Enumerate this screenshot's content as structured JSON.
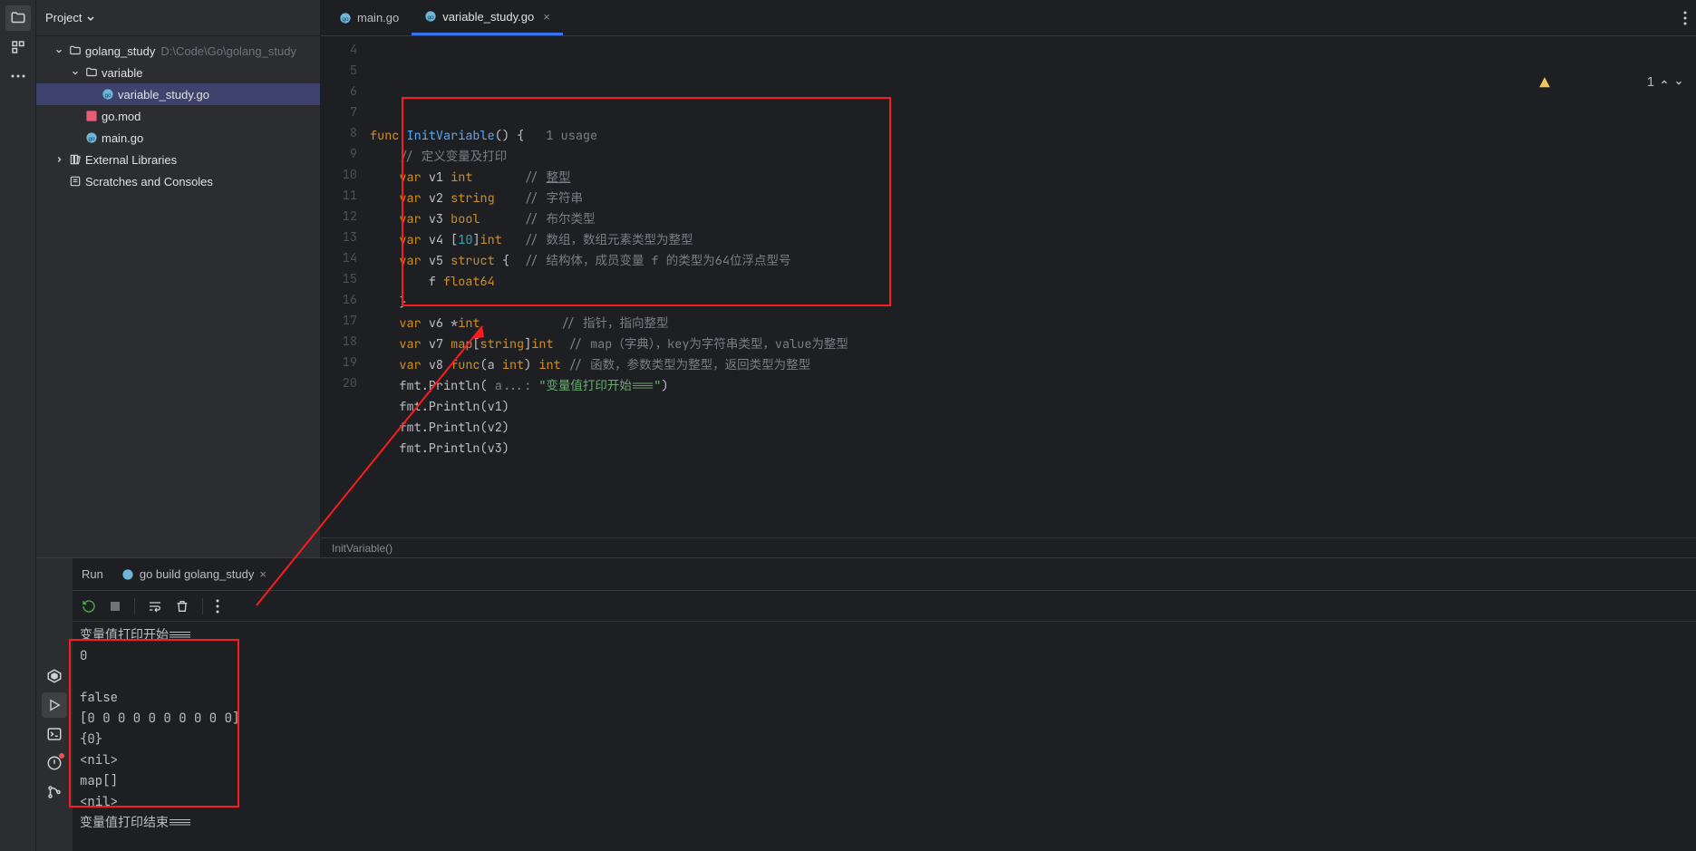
{
  "project_panel": {
    "title": "Project",
    "tree": [
      {
        "level": 0,
        "kind": "folder",
        "label": "golang_study",
        "path": "D:\\Code\\Go\\golang_study",
        "expanded": true
      },
      {
        "level": 1,
        "kind": "folder",
        "label": "variable",
        "expanded": true
      },
      {
        "level": 2,
        "kind": "gofile",
        "label": "variable_study.go",
        "selected": true
      },
      {
        "level": 1,
        "kind": "gomod",
        "label": "go.mod"
      },
      {
        "level": 1,
        "kind": "gofile",
        "label": "main.go"
      },
      {
        "level": 0,
        "kind": "lib",
        "label": "External Libraries",
        "expanded": false
      },
      {
        "level": 0,
        "kind": "scratch",
        "label": "Scratches and Consoles"
      }
    ]
  },
  "tabs": [
    {
      "label": "main.go",
      "active": false
    },
    {
      "label": "variable_study.go",
      "active": true
    }
  ],
  "indicators": {
    "warnings": "1"
  },
  "breadcrumb": "InitVariable()",
  "gutter_start": 4,
  "code_lines": [
    {
      "n": 4,
      "html": ""
    },
    {
      "n": 5,
      "html": "<span class='kw'>func</span> <span class='fn'>InitVariable</span>() {   <span class='hint'>1 usage</span>"
    },
    {
      "n": 6,
      "html": "    <span class='cmt'>// 定义变量及打印</span>"
    },
    {
      "n": 7,
      "html": "    <span class='kw'>var</span> v1 <span class='typ'>int</span>       <span class='cmt'>// <span class='underline'>整型</span></span>"
    },
    {
      "n": 8,
      "html": "    <span class='kw'>var</span> v2 <span class='typ'>string</span>    <span class='cmt'>// 字符串</span>"
    },
    {
      "n": 9,
      "html": "    <span class='kw'>var</span> v3 <span class='typ'>bool</span>      <span class='cmt'>// 布尔类型</span>"
    },
    {
      "n": 10,
      "html": "    <span class='kw'>var</span> v4 [<span class='num'>10</span>]<span class='typ'>int</span>   <span class='cmt'>// 数组，数组元素类型为整型</span>"
    },
    {
      "n": 11,
      "html": "    <span class='kw'>var</span> v5 <span class='kw'>struct</span> {  <span class='cmt'>// 结构体，成员变量 f 的类型为64位浮点型号</span>"
    },
    {
      "n": 12,
      "html": "        f <span class='typ'>float64</span>"
    },
    {
      "n": 13,
      "html": "    }"
    },
    {
      "n": 14,
      "html": "    <span class='kw'>var</span> v6 *<span class='typ'>int</span>           <span class='cmt'>// 指针，指向整型</span>"
    },
    {
      "n": 15,
      "html": "    <span class='kw'>var</span> v7 <span class='typ'>map</span>[<span class='typ'>string</span>]<span class='typ'>int</span>  <span class='cmt'>// map（字典），key为字符串类型，value为整型</span>"
    },
    {
      "n": 16,
      "html": "    <span class='kw'>var</span> v8 <span class='kw'>func</span>(a <span class='typ'>int</span>) <span class='typ'>int</span> <span class='cmt'>// 函数，参数类型为整型，返回类型为整型</span>"
    },
    {
      "n": 17,
      "html": "    fmt.Println( <span class='hint'>a...:</span> <span class='str'>\"变量值打印开始===\"</span>)"
    },
    {
      "n": 18,
      "html": "    fmt.Println(v1)"
    },
    {
      "n": 19,
      "html": "    fmt.Println(v2)"
    },
    {
      "n": 20,
      "html": "    fmt.Println(v3)"
    }
  ],
  "run": {
    "title": "Run",
    "config": "go build golang_study",
    "output": [
      "变量值打印开始===",
      "0",
      "",
      "false",
      "[0 0 0 0 0 0 0 0 0 0]",
      "{0}",
      "<nil>",
      "map[]",
      "<nil>",
      "变量值打印结束==="
    ]
  }
}
